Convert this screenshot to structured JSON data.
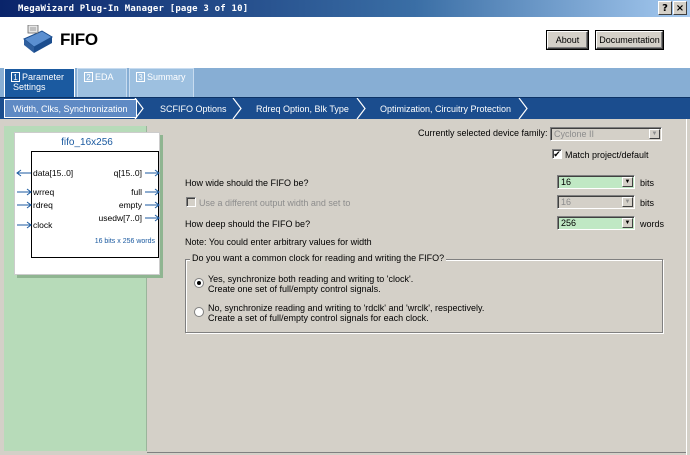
{
  "window": {
    "title": "MegaWizard Plug-In Manager [page 3 of 10]",
    "help_glyph": "?",
    "close_glyph": "×"
  },
  "header": {
    "title": "FIFO",
    "about_label": "About",
    "documentation_label": "Documentation"
  },
  "tabs": [
    {
      "num": "1",
      "label_line1": "Parameter",
      "label_line2": "Settings"
    },
    {
      "num": "2",
      "label": "EDA"
    },
    {
      "num": "3",
      "label": "Summary"
    }
  ],
  "breadcrumbs": [
    "Width, Clks, Synchronization",
    "SCFIFO Options",
    "Rdreq Option, Blk Type",
    "Optimization, Circuitry Protection"
  ],
  "symbol": {
    "name": "fifo_16x256",
    "inputs": [
      "data[15..0]",
      "wrreq",
      "rdreq",
      "clock"
    ],
    "outputs": [
      "q[15..0]",
      "full",
      "empty",
      "usedw[7..0]"
    ],
    "note": "16 bits x 256 words"
  },
  "form": {
    "device_family_label": "Currently selected device family:",
    "device_family_value": "Cyclone II",
    "match_project_label": "Match project/default",
    "match_project_checked": true,
    "width_label": "How wide should the FIFO be?",
    "width_value": "16",
    "width_unit": "bits",
    "diff_output_label": "Use a different output width and set to",
    "diff_output_value": "16",
    "diff_output_unit": "bits",
    "depth_label": "How deep should the FIFO be?",
    "depth_value": "256",
    "depth_unit": "words",
    "note": "Note: You could enter arbitrary values for width",
    "clock_group_title": "Do you want a common clock for reading and writing the FIFO?",
    "option_sync_line1": "Yes, synchronize both reading and writing to 'clock'.",
    "option_sync_line2": "Create one set of full/empty control signals.",
    "option_async_line1": "No, synchronize reading and writing to 'rdclk' and 'wrclk', respectively.",
    "option_async_line2": "Create a set of full/empty control signals for each clock.",
    "selected_option": "sync"
  },
  "glyphs": {
    "dropdown": "▼",
    "check": "✔"
  }
}
